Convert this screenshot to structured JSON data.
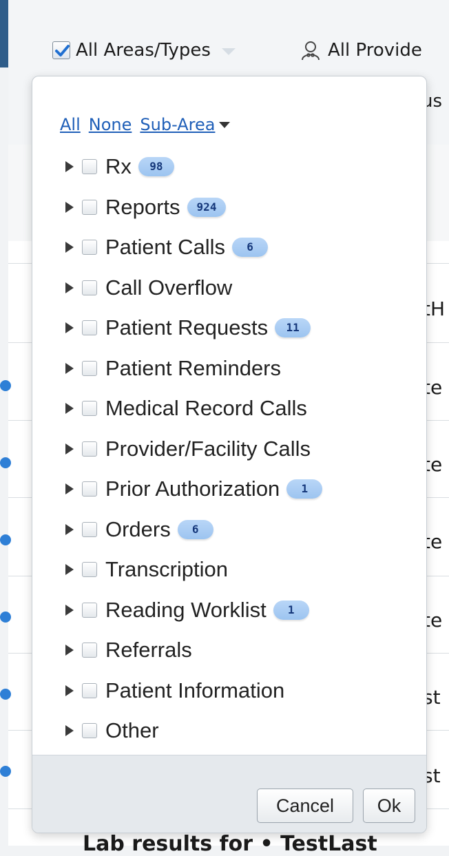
{
  "toolbar": {
    "area_filter_label": "All Areas/Types",
    "provider_filter_label": "All Provide",
    "hidden_text_1": "us"
  },
  "background_rows": [
    {
      "text": "tH"
    },
    {
      "text": "te"
    },
    {
      "text": "te"
    },
    {
      "text": "te"
    },
    {
      "text": "te"
    },
    {
      "text": "st"
    },
    {
      "text": "st"
    }
  ],
  "bottom_row_text": "Lab results for • TestLast",
  "dropdown": {
    "links": {
      "all": "All",
      "none": "None",
      "sub_area": "Sub-Area"
    },
    "items": [
      {
        "label": "Rx",
        "count": "98"
      },
      {
        "label": "Reports",
        "count": "924"
      },
      {
        "label": "Patient Calls",
        "count": "6"
      },
      {
        "label": "Call Overflow",
        "count": ""
      },
      {
        "label": "Patient Requests",
        "count": "11"
      },
      {
        "label": "Patient Reminders",
        "count": ""
      },
      {
        "label": "Medical Record Calls",
        "count": ""
      },
      {
        "label": "Provider/Facility Calls",
        "count": ""
      },
      {
        "label": "Prior Authorization",
        "count": "1"
      },
      {
        "label": "Orders",
        "count": "6"
      },
      {
        "label": "Transcription",
        "count": ""
      },
      {
        "label": "Reading Worklist",
        "count": "1"
      },
      {
        "label": "Referrals",
        "count": ""
      },
      {
        "label": "Patient Information",
        "count": ""
      },
      {
        "label": "Other",
        "count": ""
      }
    ],
    "cancel_label": "Cancel",
    "ok_label": "Ok"
  },
  "colors": {
    "link": "#1f5fb8",
    "badge": "#a9ccf3",
    "badge_text": "#15377a",
    "row_dot": "#2e7fd6"
  }
}
